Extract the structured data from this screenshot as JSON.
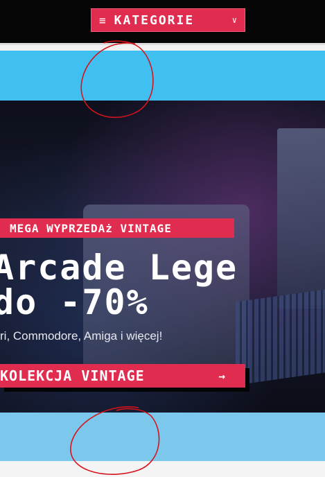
{
  "header": {
    "category_button": {
      "icon": "menu-icon",
      "label": "KATEGORIE",
      "chevron": "chevron-down-icon"
    }
  },
  "hero": {
    "badge": "MEGA WYPRZEDAż VINTAGE",
    "title_line1": "Arcade Lege",
    "title_line2": "do -70%",
    "subtitle": "ri, Commodore, Amiga i więcej!",
    "cta_label": "KOLEKCJA VINTAGE",
    "cta_icon": "arrow-right-icon"
  },
  "colors": {
    "accent": "#e02c4f",
    "band_top": "#40c0f0",
    "band_bottom": "#7cc8ec",
    "annotation": "#d8121a"
  }
}
